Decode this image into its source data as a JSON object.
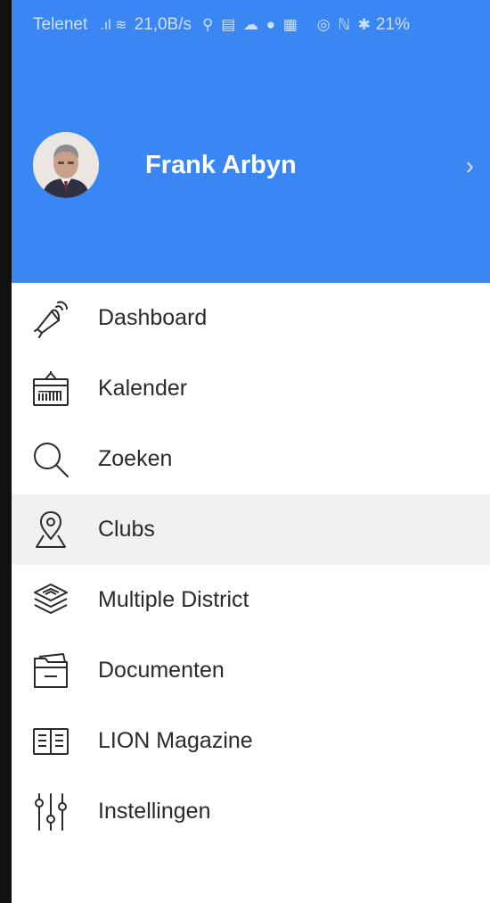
{
  "status_bar": {
    "carrier": "Telenet",
    "rate": "21,0B/s",
    "battery": "21%"
  },
  "profile": {
    "name": "Frank Arbyn",
    "chevron": "›"
  },
  "menu": {
    "items": [
      {
        "label": "Dashboard",
        "icon": "megaphone-icon",
        "active": false
      },
      {
        "label": "Kalender",
        "icon": "calendar-icon",
        "active": false
      },
      {
        "label": "Zoeken",
        "icon": "search-icon",
        "active": false
      },
      {
        "label": "Clubs",
        "icon": "location-pin-icon",
        "active": true
      },
      {
        "label": "Multiple District",
        "icon": "layers-icon",
        "active": false
      },
      {
        "label": "Documenten",
        "icon": "folder-icon",
        "active": false
      },
      {
        "label": "LION Magazine",
        "icon": "book-icon",
        "active": false
      },
      {
        "label": "Instellingen",
        "icon": "sliders-icon",
        "active": false
      }
    ]
  },
  "colors": {
    "header_blue": "#3a86f2",
    "active_row": "#f1f1f1",
    "text": "#2a2a2a"
  }
}
